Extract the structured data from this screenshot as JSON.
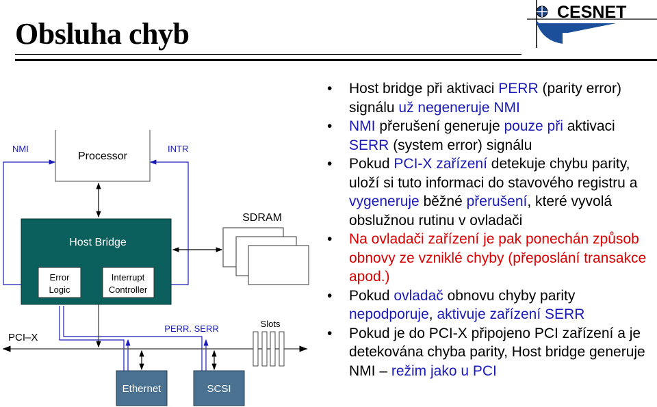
{
  "slide": {
    "title": "Obsluha chyb",
    "logo_text": "CESNET"
  },
  "colors": {
    "text": "#000000",
    "highlight_blue": "#1a1ab8",
    "highlight_red": "#d80000",
    "host_bridge_fill": "#0b5f5c",
    "device_fill": "#4a7290",
    "signal_line": "#1a1ab8",
    "bus_line": "#555555"
  },
  "diagram": {
    "processor": "Processor",
    "host_bridge": "Host Bridge",
    "error_logic_1": "Error",
    "error_logic_2": "Logic",
    "interrupt_1": "Interrupt",
    "interrupt_2": "Controller",
    "sdram": "SDRAM",
    "nmi": "NMI",
    "intr": "INTR",
    "pcix": "PCI–X",
    "perr_serr": "PERR. SERR",
    "slots": "Slots",
    "ethernet": "Ethernet",
    "scsi": "SCSI"
  },
  "bullets": [
    {
      "segments": [
        {
          "t": "Host bridge při aktivaci ",
          "c": ""
        },
        {
          "t": "PERR",
          "c": "blue"
        },
        {
          "t": " (parity error) signálu ",
          "c": ""
        },
        {
          "t": "už negeneruje NMI",
          "c": "blue"
        }
      ]
    },
    {
      "segments": [
        {
          "t": "NMI",
          "c": "blue"
        },
        {
          "t": " přerušení generuje ",
          "c": ""
        },
        {
          "t": "pouze při",
          "c": "blue"
        },
        {
          "t": " aktivaci ",
          "c": ""
        },
        {
          "t": "SERR",
          "c": "blue"
        },
        {
          "t": " (system error) signálu",
          "c": ""
        }
      ]
    },
    {
      "segments": [
        {
          "t": "Pokud ",
          "c": ""
        },
        {
          "t": "PCI-X zařízení",
          "c": "blue"
        },
        {
          "t": " detekuje chybu parity, uloží si tuto informaci do stavového registru a ",
          "c": ""
        },
        {
          "t": "vygeneruje",
          "c": "blue"
        },
        {
          "t": " běžné ",
          "c": ""
        },
        {
          "t": "přerušení",
          "c": "blue"
        },
        {
          "t": ", které vyvolá obslužnou rutinu v ovladači",
          "c": ""
        }
      ]
    },
    {
      "segments": [
        {
          "t": "Na ovladači zařízení je pak ponechán způsob obnovy ze vzniklé chyby (přeposlání transakce apod.)",
          "c": "red"
        }
      ]
    },
    {
      "segments": [
        {
          "t": "Pokud ",
          "c": ""
        },
        {
          "t": "ovladač",
          "c": "blue"
        },
        {
          "t": " obnovu chyby parity ",
          "c": ""
        },
        {
          "t": "nepodporuje",
          "c": "blue"
        },
        {
          "t": ", ",
          "c": ""
        },
        {
          "t": "aktivuje zařízení SERR",
          "c": "blue"
        }
      ]
    },
    {
      "segments": [
        {
          "t": "Pokud je do PCI-X připojeno PCI zařízení a je detekována chyba parity, Host bridge generuje NMI – ",
          "c": ""
        },
        {
          "t": "režim jako u PCI",
          "c": "blue"
        }
      ]
    }
  ]
}
